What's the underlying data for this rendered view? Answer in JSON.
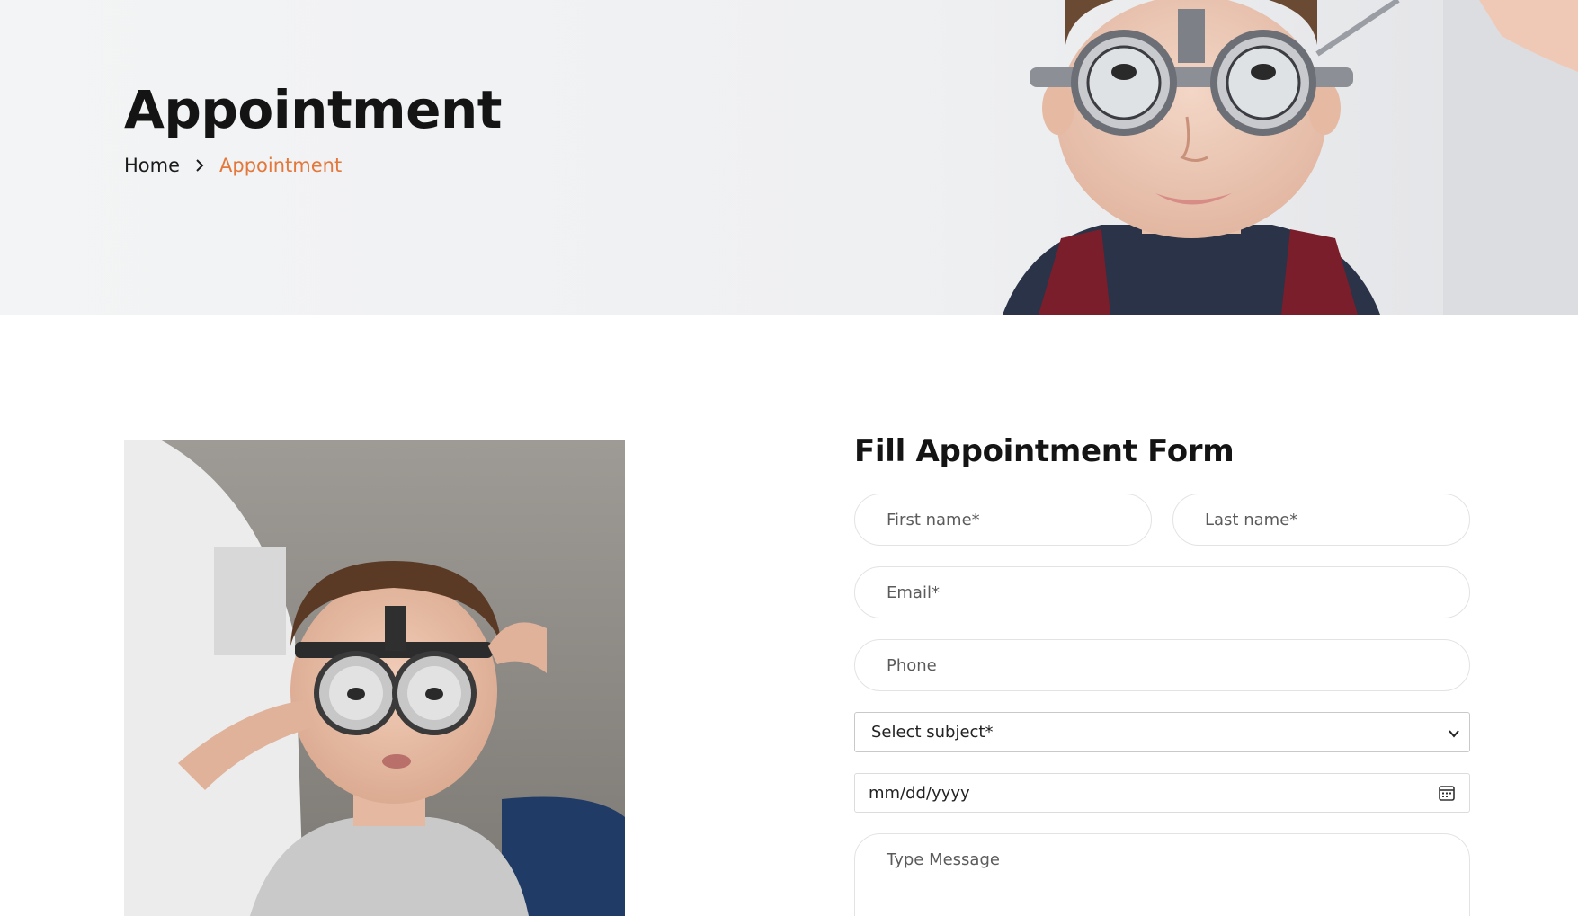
{
  "hero": {
    "title": "Appointment",
    "breadcrumb": {
      "home": "Home",
      "current": "Appointment"
    }
  },
  "form": {
    "title": "Fill Appointment Form",
    "first_name_placeholder": "First name*",
    "last_name_placeholder": "Last name*",
    "email_placeholder": "Email*",
    "phone_placeholder": "Phone",
    "subject_selected": "Select subject*",
    "date_placeholder": "mm/dd/yyyy",
    "message_placeholder": "Type Message"
  },
  "colors": {
    "accent": "#e4773a",
    "text_dark": "#141414",
    "field_border": "#e3e3e3"
  },
  "icons": {
    "breadcrumb_separator": "chevron-right-icon",
    "select_arrow": "chevron-down-icon",
    "date_picker": "calendar-icon"
  }
}
